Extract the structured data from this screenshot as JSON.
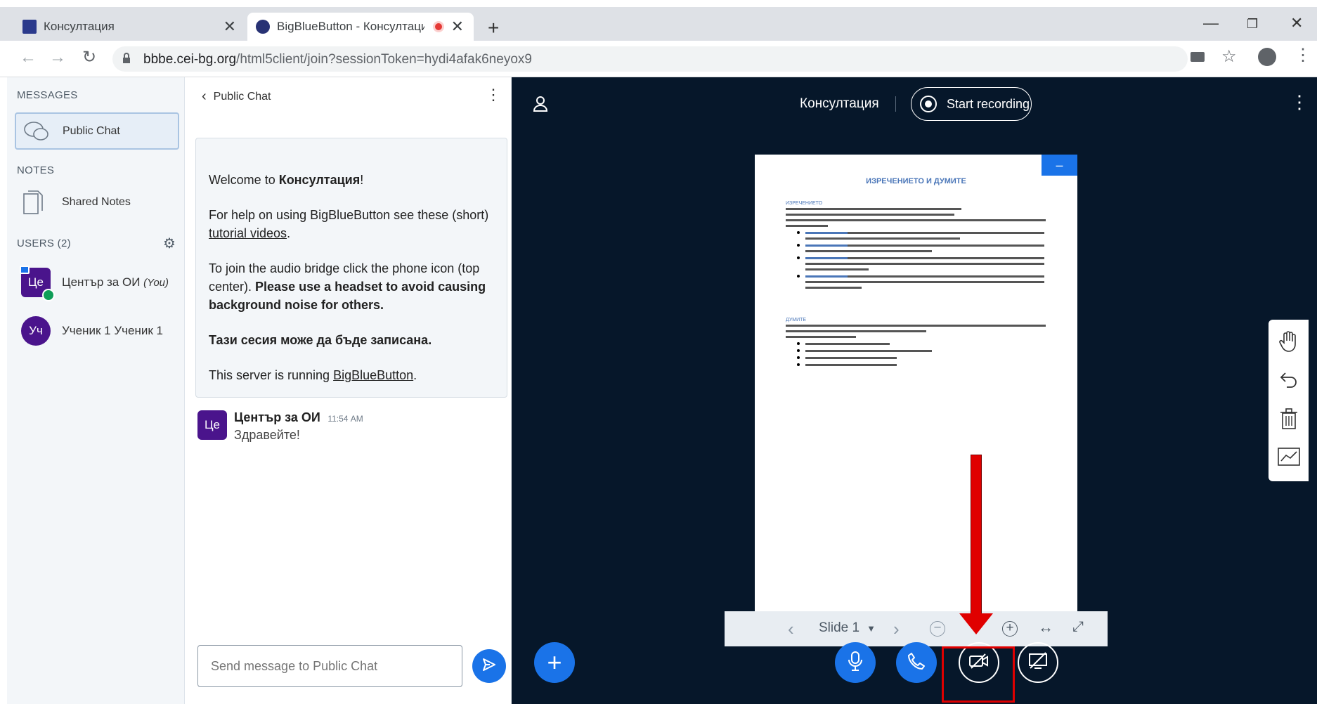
{
  "browser": {
    "tabs": [
      {
        "title": "Консултация"
      },
      {
        "title": "BigBlueButton - Консултаци"
      }
    ],
    "url_host": "bbbe.cei-bg.org",
    "url_path": "/html5client/join?sessionToken=hydi4afak6neyox9"
  },
  "sidebar": {
    "messages_title": "MESSAGES",
    "public_chat_label": "Public Chat",
    "notes_title": "NOTES",
    "shared_notes_label": "Shared Notes",
    "users_title": "USERS (2)",
    "users": [
      {
        "initials": "Це",
        "name": "Център за ОИ",
        "you_label": "(You)"
      },
      {
        "initials": "Уч",
        "name": "Ученик 1 Ученик 1"
      }
    ]
  },
  "chat": {
    "header": "Public Chat",
    "welcome": {
      "line1_prefix": "Welcome to ",
      "line1_room": "Консултация",
      "line1_suffix": "!",
      "help_text": "For help on using BigBlueButton see these (short) ",
      "help_link": "tutorial videos",
      "help_end": ".",
      "audio_text": "To join the audio bridge click the phone icon (top center). ",
      "audio_bold": "Please use a headset to avoid causing background noise for others.",
      "recorded": "Тази сесия може да бъде записана.",
      "server_text": "This server is running ",
      "server_link": "BigBlueButton",
      "server_end": "."
    },
    "messages": [
      {
        "initials": "Це",
        "sender": "Център за ОИ",
        "time": "11:54 AM",
        "text": "Здравейте!"
      }
    ],
    "input_placeholder": "Send message to Public Chat"
  },
  "presentation": {
    "meeting_name": "Консултация",
    "record_label": "Start recording",
    "slide_label": "Slide 1",
    "slide": {
      "title": "ИЗРЕЧЕНИЕТО И ДУМИТЕ",
      "heading1": "ИЗРЕЧЕНИЕТО",
      "heading2": "ДУМИТЕ"
    }
  },
  "colors": {
    "accent": "#1a73e8",
    "dark_bg": "#06172a",
    "avatar": "#4a148c",
    "highlight": "#e00000"
  }
}
